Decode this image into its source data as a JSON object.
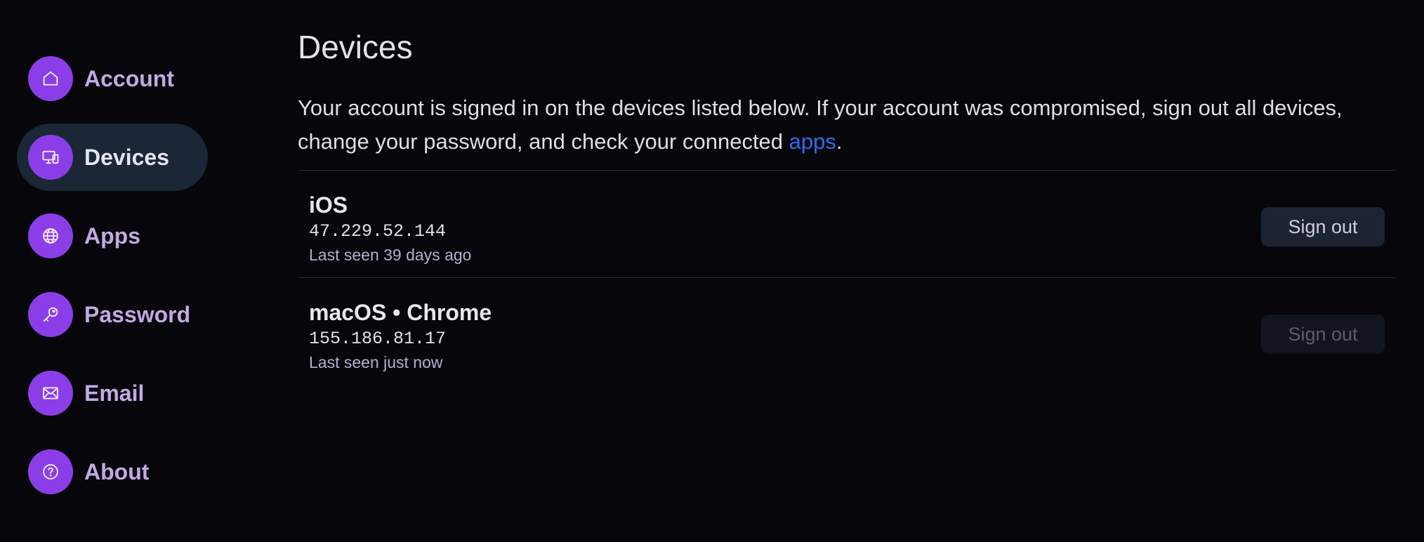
{
  "sidebar": {
    "items": [
      {
        "label": "Account",
        "icon": "home-icon",
        "active": false
      },
      {
        "label": "Devices",
        "icon": "devices-icon",
        "active": true
      },
      {
        "label": "Apps",
        "icon": "globe-icon",
        "active": false
      },
      {
        "label": "Password",
        "icon": "key-icon",
        "active": false
      },
      {
        "label": "Email",
        "icon": "mail-icon",
        "active": false
      },
      {
        "label": "About",
        "icon": "help-icon",
        "active": false
      }
    ]
  },
  "main": {
    "title": "Devices",
    "description_text": "Your account is signed in on the devices listed below. If your account was compromised, sign out all devices, change your password, and check your connected ",
    "description_link": "apps",
    "description_end": "."
  },
  "devices": [
    {
      "name": "iOS",
      "ip": "47.229.52.144",
      "last_seen": "Last seen 39 days ago",
      "signout_label": "Sign out",
      "signout_enabled": true
    },
    {
      "name": "macOS • Chrome",
      "ip": "155.186.81.17",
      "last_seen": "Last seen just now",
      "signout_label": "Sign out",
      "signout_enabled": false
    }
  ],
  "colors": {
    "background": "#07060b",
    "accent": "#8b3ee8",
    "active_nav": "#1b2636",
    "link": "#2f6bf0"
  }
}
